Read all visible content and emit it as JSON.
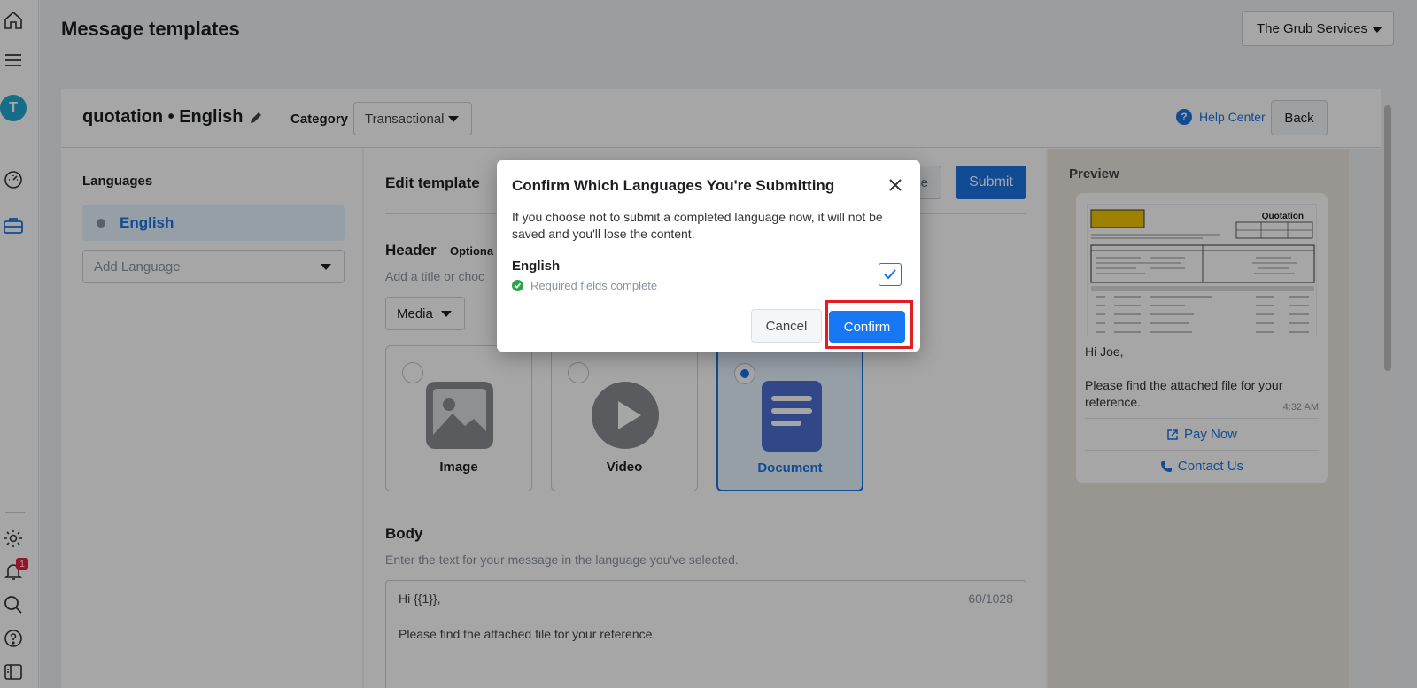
{
  "page": {
    "title": "Message templates"
  },
  "business": {
    "selected": "The Grub Services"
  },
  "template": {
    "name": "quotation • English",
    "category_label": "Category",
    "category_value": "Transactional"
  },
  "top_actions": {
    "help": "Help Center",
    "back": "Back"
  },
  "languages": {
    "title": "Languages",
    "items": [
      {
        "label": "English"
      }
    ],
    "add_placeholder": "Add Language"
  },
  "editor": {
    "title": "Edit template",
    "sample_label": "mple",
    "submit_label": "Submit",
    "header": {
      "title": "Header",
      "optional": "Optiona",
      "description": "Add a title or choc",
      "media_value": "Media",
      "options": [
        {
          "label": "Image",
          "icon": "image-icon",
          "selected": false
        },
        {
          "label": "Video",
          "icon": "video-play-icon",
          "selected": false
        },
        {
          "label": "Document",
          "icon": "document-icon",
          "selected": true
        }
      ]
    },
    "body": {
      "title": "Body",
      "description": "Enter the text for your message in the language you've selected.",
      "line1": "Hi {{1}},",
      "line2": "Please find the attached file for your reference.",
      "counter": "60/1028"
    }
  },
  "preview": {
    "title": "Preview",
    "doc_heading": "Quotation",
    "greeting": "Hi Joe,",
    "message": "Please find the attached file for your reference.",
    "time": "4:32 AM",
    "buttons": [
      {
        "label": "Pay Now",
        "icon": "external-link-icon"
      },
      {
        "label": "Contact Us",
        "icon": "phone-icon"
      }
    ]
  },
  "modal": {
    "title": "Confirm Which Languages You're Submitting",
    "description": "If you choose not to submit a completed language now, it will not be saved and you'll lose the content.",
    "language": "English",
    "status": "Required fields complete",
    "cancel": "Cancel",
    "confirm": "Confirm"
  },
  "notifications": {
    "count": "1"
  },
  "colors": {
    "accent": "#1b74e4",
    "success": "#31a24c",
    "highlight": "#e51c23",
    "avatar": "#23a8cf"
  },
  "avatar": {
    "initial": "T"
  }
}
